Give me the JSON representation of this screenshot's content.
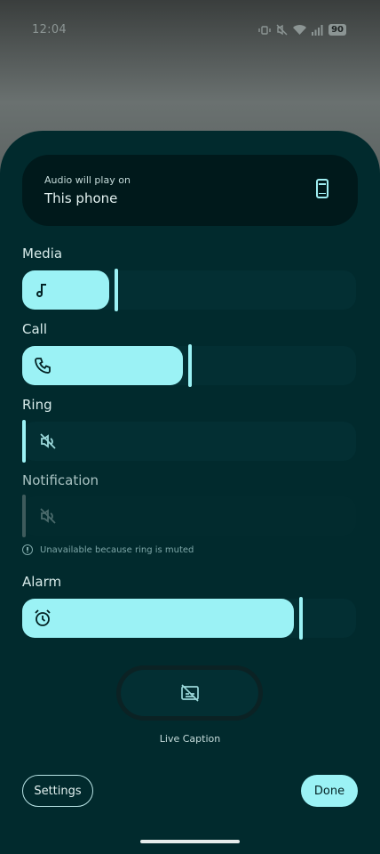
{
  "status_bar": {
    "time": "12:04",
    "battery": "90",
    "icons": [
      "vibrate-icon",
      "mute-icon",
      "wifi-icon",
      "signal-icon",
      "battery-icon"
    ]
  },
  "output": {
    "subtitle": "Audio will play on",
    "device": "This phone",
    "icon": "phone-icon"
  },
  "sliders": [
    {
      "label": "Media",
      "icon": "music-note-icon",
      "level_percent": 27,
      "enabled": true
    },
    {
      "label": "Call",
      "icon": "phone-call-icon",
      "level_percent": 50,
      "enabled": true
    },
    {
      "label": "Ring",
      "icon": "volume-off-icon",
      "level_percent": 0,
      "enabled": true
    },
    {
      "label": "Notification",
      "icon": "volume-off-icon",
      "level_percent": 0,
      "enabled": false
    },
    {
      "label": "Alarm",
      "icon": "alarm-icon",
      "level_percent": 83,
      "enabled": true
    }
  ],
  "notification_note": "Unavailable because ring is muted",
  "live_caption": {
    "label": "Live Caption",
    "icon": "live-caption-icon"
  },
  "buttons": {
    "settings": "Settings",
    "done": "Done"
  },
  "colors": {
    "accent": "#9bf2f5",
    "sheet": "#012a2d",
    "track": "#032f33"
  }
}
